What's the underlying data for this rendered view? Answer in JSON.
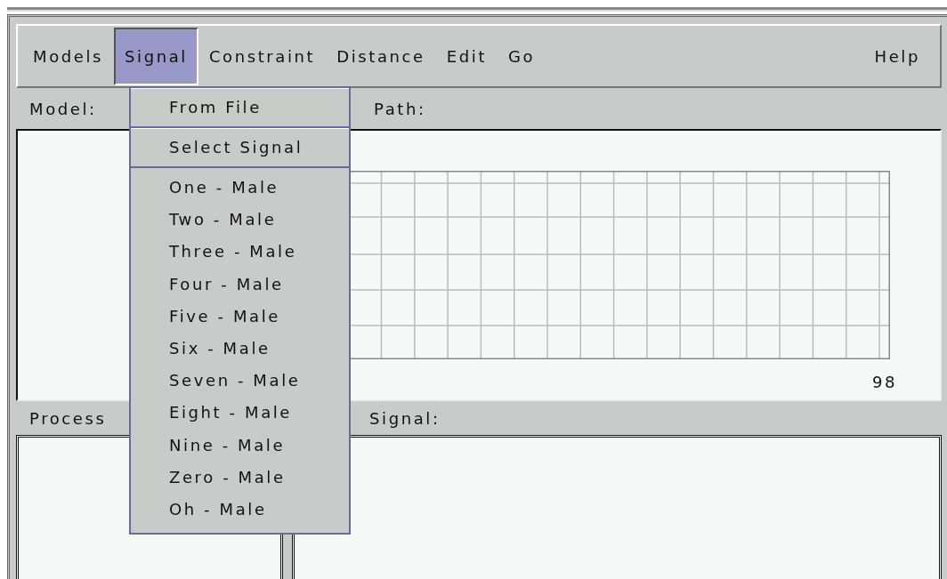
{
  "menu_bar": {
    "items": [
      {
        "label": "Models",
        "selected": false
      },
      {
        "label": "Signal",
        "selected": true
      },
      {
        "label": "Constraint",
        "selected": false
      },
      {
        "label": "Distance",
        "selected": false
      },
      {
        "label": "Edit",
        "selected": false
      },
      {
        "label": "Go",
        "selected": false
      }
    ],
    "help": {
      "label": "Help",
      "selected": false
    }
  },
  "signal_menu": {
    "items": [
      {
        "label": "From File",
        "kind": "action"
      },
      {
        "label": "Select Signal",
        "kind": "action"
      },
      {
        "label": "One - Male",
        "kind": "signal"
      },
      {
        "label": "Two - Male",
        "kind": "signal"
      },
      {
        "label": "Three - Male",
        "kind": "signal"
      },
      {
        "label": "Four - Male",
        "kind": "signal"
      },
      {
        "label": "Five - Male",
        "kind": "signal"
      },
      {
        "label": "Six - Male",
        "kind": "signal"
      },
      {
        "label": "Seven - Male",
        "kind": "signal"
      },
      {
        "label": "Eight - Male",
        "kind": "signal"
      },
      {
        "label": "Nine - Male",
        "kind": "signal"
      },
      {
        "label": "Zero - Male",
        "kind": "signal"
      },
      {
        "label": "Oh - Male",
        "kind": "signal"
      }
    ]
  },
  "model_panel": {
    "label": "Model:"
  },
  "path_panel": {
    "label": "Path:",
    "axis_end": "98"
  },
  "process_panel": {
    "label": "Process"
  },
  "signal_panel": {
    "label": "Signal:"
  }
}
